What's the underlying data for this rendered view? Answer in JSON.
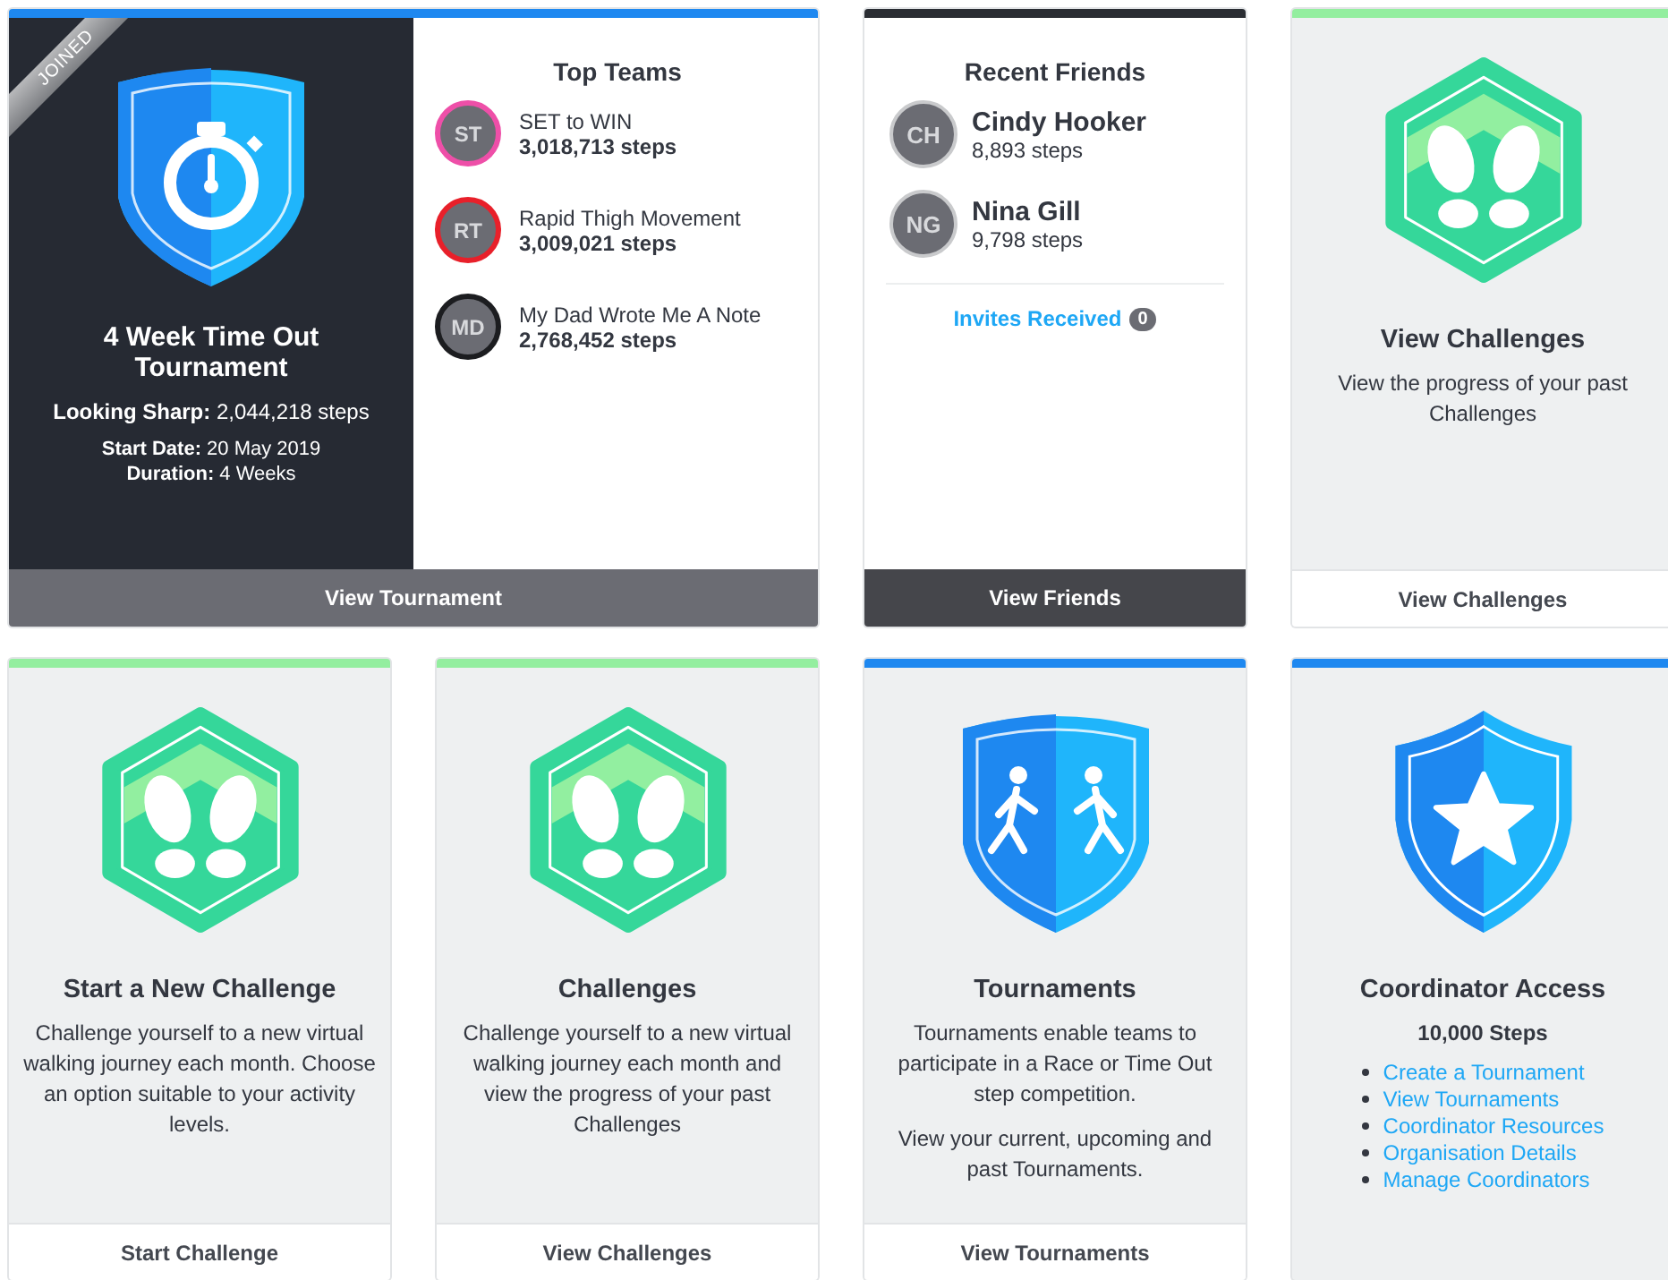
{
  "tournament_card": {
    "ribbon": "JOINED",
    "title": "4 Week Time Out Tournament",
    "team_line": "**Looking Sharp:** 2,044,218 steps",
    "start_line": "**Start Date:** 20 May 2019",
    "duration_line": "**Duration:** 4 Weeks",
    "top_teams": {
      "title": "Top Teams",
      "teams": [
        {
          "initials": "ST",
          "name": "SET to WIN",
          "steps": "3,018,713 steps",
          "color": "#ee4fa8"
        },
        {
          "initials": "RT",
          "name": "Rapid Thigh Movement",
          "steps": "3,009,021 steps",
          "color": "#e8202a"
        },
        {
          "initials": "MD",
          "name": "My Dad Wrote Me A Note",
          "steps": "2,768,452 steps",
          "color": "#1c1d20"
        }
      ]
    },
    "button": "View Tournament"
  },
  "friends_card": {
    "title": "Recent Friends",
    "friends": [
      {
        "initials": "CH",
        "name": "Cindy Hooker",
        "steps": "8,893 steps"
      },
      {
        "initials": "NG",
        "name": "Nina Gill",
        "steps": "9,798 steps"
      }
    ],
    "invites": {
      "label": "Invites Received",
      "count": "0"
    },
    "button": "View Friends"
  },
  "feature_cards": [
    {
      "kind": "challenge",
      "title": "View Challenges",
      "paragraphs": [
        "View the progress of your past Challenges"
      ],
      "button": "View Challenges"
    },
    {
      "kind": "challenge",
      "title": "Start a New Challenge",
      "paragraphs": [
        "Challenge yourself to a new virtual walking journey each month. Choose an option suitable to your activity levels."
      ],
      "button": "Start Challenge"
    },
    {
      "kind": "challenge",
      "title": "Challenges",
      "paragraphs": [
        "Challenge yourself to a new virtual walking journey each month and view the progress of your past Challenges"
      ],
      "button": "View Challenges"
    },
    {
      "kind": "tournament",
      "title": "Tournaments",
      "paragraphs": [
        "Tournaments enable teams to participate in a Race or Time Out step competition.",
        "View your current, upcoming and past Tournaments."
      ],
      "button": "View Tournaments"
    },
    {
      "kind": "coordinator",
      "title": "Coordinator Access",
      "subtitle": "10,000 Steps",
      "links": [
        "Create a Tournament",
        "View Tournaments",
        "Coordinator Resources",
        "Organisation Details",
        "Manage Coordinators"
      ]
    }
  ]
}
